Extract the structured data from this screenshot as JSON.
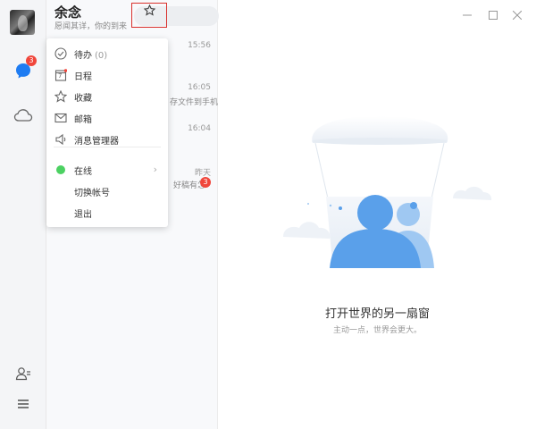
{
  "profile": {
    "name": "余念",
    "signature": "愿闻其详，你的到来"
  },
  "nav": {
    "chat_badge": "3"
  },
  "menu": {
    "items": [
      {
        "label": "待办",
        "count": "(0)"
      },
      {
        "label": "日程"
      },
      {
        "label": "收藏"
      },
      {
        "label": "邮箱"
      },
      {
        "label": "消息管理器"
      },
      {
        "label": "在线"
      },
      {
        "label": "切换帐号"
      },
      {
        "label": "退出"
      }
    ],
    "calendar_day": "7"
  },
  "chats": [
    {
      "time": "15:56",
      "snippet": ""
    },
    {
      "time": "16:05",
      "snippet": "存文件到手机"
    },
    {
      "time": "16:04",
      "snippet": ""
    },
    {
      "time": "昨天",
      "snippet": "好稿有怎",
      "badge": "3"
    }
  ],
  "main": {
    "title": "打开世界的另一扇窗",
    "subtitle": "主动一点，世界会更大。"
  },
  "colors": {
    "accent": "#1e7cf2",
    "badge": "#f0463b",
    "online": "#4cd162",
    "highlight_border": "#d9302c"
  }
}
